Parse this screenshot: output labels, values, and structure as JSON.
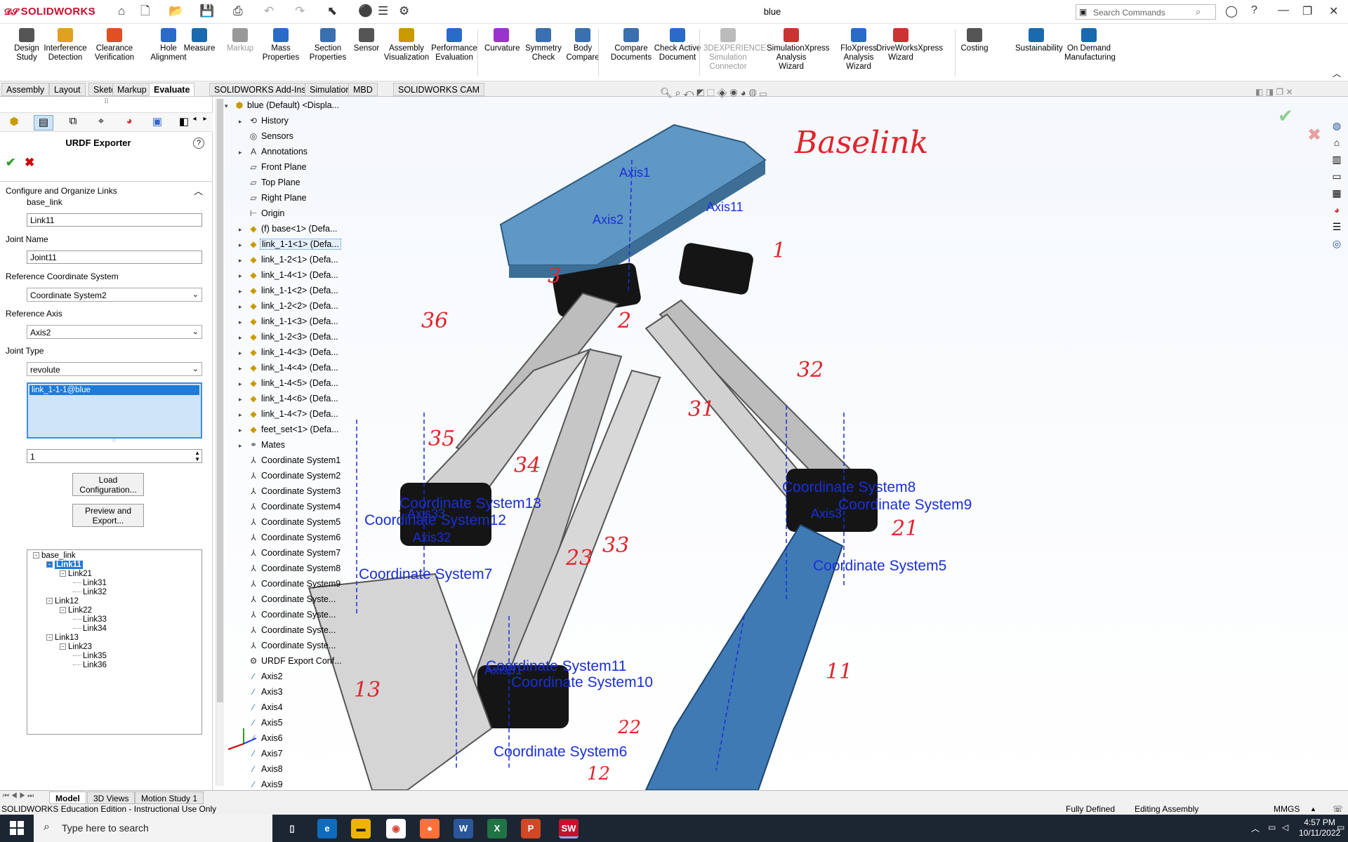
{
  "app": {
    "logo": "SOLIDWORKS",
    "window_title": "blue"
  },
  "search": {
    "placeholder": "Search Commands"
  },
  "ribbon": [
    {
      "label": "Design Study",
      "icon": "design-study-icon"
    },
    {
      "label": "Interference Detection",
      "icon": "interference-icon"
    },
    {
      "label": "Clearance Verification",
      "icon": "clearance-icon"
    },
    {
      "label": "Hole Alignment",
      "icon": "hole-alignment-icon"
    },
    {
      "label": "Measure",
      "icon": "measure-icon"
    },
    {
      "label": "Markup",
      "icon": "markup-icon",
      "disabled": true
    },
    {
      "label": "Mass Properties",
      "icon": "mass-properties-icon"
    },
    {
      "label": "Section Properties",
      "icon": "section-properties-icon"
    },
    {
      "label": "Sensor",
      "icon": "sensor-icon"
    },
    {
      "label": "Assembly Visualization",
      "icon": "assembly-visualization-icon"
    },
    {
      "label": "Performance Evaluation",
      "icon": "performance-icon"
    },
    {
      "label": "Curvature",
      "icon": "curvature-icon"
    },
    {
      "label": "Symmetry Check",
      "icon": "symmetry-icon"
    },
    {
      "label": "Body Compare",
      "icon": "body-compare-icon"
    },
    {
      "label": "Compare Documents",
      "icon": "compare-documents-icon"
    },
    {
      "label": "Check Active Document",
      "icon": "check-document-icon"
    },
    {
      "label": "3DEXPERIENCE Simulation Connector",
      "icon": "3dx-icon",
      "disabled": true
    },
    {
      "label": "SimulationXpress Analysis Wizard",
      "icon": "simxpress-icon"
    },
    {
      "label": "FloXpress Analysis Wizard",
      "icon": "floxpress-icon"
    },
    {
      "label": "DriveWorksXpress Wizard",
      "icon": "driveworks-icon"
    },
    {
      "label": "Costing",
      "icon": "costing-icon"
    },
    {
      "label": "Sustainability",
      "icon": "sustainability-icon"
    },
    {
      "label": "On Demand Manufacturing",
      "icon": "manufacturing-icon"
    }
  ],
  "tabs": [
    "Assembly",
    "Layout",
    "Sketch",
    "Markup",
    "Evaluate",
    "SOLIDWORKS Add-Ins",
    "Simulation",
    "MBD",
    "SOLIDWORKS CAM"
  ],
  "panel": {
    "title": "URDF Exporter",
    "section": "Configure and Organize Links",
    "link_label": "base_link",
    "link_value": "Link11",
    "joint_name_label": "Joint Name",
    "joint_name_value": "Joint11",
    "ref_cs_label": "Reference Coordinate System",
    "ref_cs_value": "Coordinate System2",
    "ref_axis_label": "Reference Axis",
    "ref_axis_value": "Axis2",
    "joint_type_label": "Joint Type",
    "joint_type_value": "revolute",
    "list_selected": "link_1-1-1@blue",
    "spinner_value": "1",
    "load_button": "Load Configuration...",
    "preview_button": "Preview and Export..."
  },
  "link_tree": [
    {
      "label": "base_link",
      "level": 0,
      "box": "-"
    },
    {
      "label": "Link11",
      "level": 1,
      "box": "-",
      "selected": true
    },
    {
      "label": "Link21",
      "level": 2,
      "box": "-"
    },
    {
      "label": "Link31",
      "level": 3
    },
    {
      "label": "Link32",
      "level": 3
    },
    {
      "label": "Link12",
      "level": 1,
      "box": "-"
    },
    {
      "label": "Link22",
      "level": 2,
      "box": "-"
    },
    {
      "label": "Link33",
      "level": 3
    },
    {
      "label": "Link34",
      "level": 3
    },
    {
      "label": "Link13",
      "level": 1,
      "box": "-"
    },
    {
      "label": "Link23",
      "level": 2,
      "box": "-"
    },
    {
      "label": "Link35",
      "level": 3
    },
    {
      "label": "Link36",
      "level": 3
    }
  ],
  "feature_tree": [
    {
      "label": "blue (Default) <Displa...",
      "exp": "▾",
      "icon": "assembly-icon"
    },
    {
      "label": "History",
      "exp": "▸",
      "icon": "history-icon"
    },
    {
      "label": "Sensors",
      "exp": "",
      "icon": "sensor-icon"
    },
    {
      "label": "Annotations",
      "exp": "▸",
      "icon": "annotation-icon"
    },
    {
      "label": "Front Plane",
      "exp": "",
      "icon": "plane-icon"
    },
    {
      "label": "Top Plane",
      "exp": "",
      "icon": "plane-icon"
    },
    {
      "label": "Right Plane",
      "exp": "",
      "icon": "plane-icon"
    },
    {
      "label": "Origin",
      "exp": "",
      "icon": "origin-icon"
    },
    {
      "label": "(f) base<1> (Defa...",
      "exp": "▸",
      "icon": "part-icon"
    },
    {
      "label": "link_1-1<1> (Defa...",
      "exp": "▸",
      "icon": "part-icon",
      "selected": true
    },
    {
      "label": "link_1-2<1> (Defa...",
      "exp": "▸",
      "icon": "part-icon"
    },
    {
      "label": "link_1-4<1> (Defa...",
      "exp": "▸",
      "icon": "part-icon"
    },
    {
      "label": "link_1-1<2> (Defa...",
      "exp": "▸",
      "icon": "part-icon"
    },
    {
      "label": "link_1-2<2> (Defa...",
      "exp": "▸",
      "icon": "part-icon"
    },
    {
      "label": "link_1-1<3> (Defa...",
      "exp": "▸",
      "icon": "part-icon"
    },
    {
      "label": "link_1-2<3> (Defa...",
      "exp": "▸",
      "icon": "part-icon"
    },
    {
      "label": "link_1-4<3> (Defa...",
      "exp": "▸",
      "icon": "part-icon"
    },
    {
      "label": "link_1-4<4> (Defa...",
      "exp": "▸",
      "icon": "part-icon"
    },
    {
      "label": "link_1-4<5> (Defa...",
      "exp": "▸",
      "icon": "part-icon"
    },
    {
      "label": "link_1-4<6> (Defa...",
      "exp": "▸",
      "icon": "part-icon"
    },
    {
      "label": "link_1-4<7> (Defa...",
      "exp": "▸",
      "icon": "part-icon"
    },
    {
      "label": "feet_set<1> (Defa...",
      "exp": "▸",
      "icon": "part-icon"
    },
    {
      "label": "Mates",
      "exp": "▸",
      "icon": "mates-icon"
    },
    {
      "label": "Coordinate System1",
      "exp": "",
      "icon": "coordinate-system-icon"
    },
    {
      "label": "Coordinate System2",
      "exp": "",
      "icon": "coordinate-system-icon"
    },
    {
      "label": "Coordinate System3",
      "exp": "",
      "icon": "coordinate-system-icon"
    },
    {
      "label": "Coordinate System4",
      "exp": "",
      "icon": "coordinate-system-icon"
    },
    {
      "label": "Coordinate System5",
      "exp": "",
      "icon": "coordinate-system-icon"
    },
    {
      "label": "Coordinate System6",
      "exp": "",
      "icon": "coordinate-system-icon"
    },
    {
      "label": "Coordinate System7",
      "exp": "",
      "icon": "coordinate-system-icon"
    },
    {
      "label": "Coordinate System8",
      "exp": "",
      "icon": "coordinate-system-icon"
    },
    {
      "label": "Coordinate System9",
      "exp": "",
      "icon": "coordinate-system-icon"
    },
    {
      "label": "Coordinate Syste...",
      "exp": "",
      "icon": "coordinate-system-icon"
    },
    {
      "label": "Coordinate Syste...",
      "exp": "",
      "icon": "coordinate-system-icon"
    },
    {
      "label": "Coordinate Syste...",
      "exp": "",
      "icon": "coordinate-system-icon"
    },
    {
      "label": "Coordinate Syste...",
      "exp": "",
      "icon": "coordinate-system-icon"
    },
    {
      "label": "URDF Export Conf...",
      "exp": "",
      "icon": "urdf-config-icon"
    },
    {
      "label": "Axis2",
      "exp": "",
      "icon": "axis-icon"
    },
    {
      "label": "Axis3",
      "exp": "",
      "icon": "axis-icon"
    },
    {
      "label": "Axis4",
      "exp": "",
      "icon": "axis-icon"
    },
    {
      "label": "Axis5",
      "exp": "",
      "icon": "axis-icon"
    },
    {
      "label": "Axis6",
      "exp": "",
      "icon": "axis-icon"
    },
    {
      "label": "Axis7",
      "exp": "",
      "icon": "axis-icon"
    },
    {
      "label": "Axis8",
      "exp": "",
      "icon": "axis-icon"
    },
    {
      "label": "Axis9",
      "exp": "",
      "icon": "axis-icon"
    }
  ],
  "annotations": {
    "hand": [
      "Baselink",
      "1",
      "2",
      "3",
      "36",
      "35",
      "34",
      "33",
      "32",
      "31",
      "21",
      "22",
      "23",
      "13",
      "12",
      "11"
    ],
    "coord": [
      "Coordinate System13",
      "Coordinate System12",
      "Coordinate System7",
      "Coordinate System8",
      "Coordinate System9",
      "Coordinate System5",
      "Coordinate System11",
      "Coordinate System10",
      "Coordinate System6"
    ],
    "axes": [
      "Axis1",
      "Axis2",
      "Axis11",
      "Axis33",
      "Axis32",
      "Axis31",
      "Axis3"
    ]
  },
  "bottom_tabs": [
    "Model",
    "3D Views",
    "Motion Study 1"
  ],
  "status": {
    "edition": "SOLIDWORKS Education Edition - Instructional Use Only",
    "defined": "Fully Defined",
    "mode": "Editing Assembly",
    "units": "MMGS"
  },
  "taskbar": {
    "search_placeholder": "Type here to search",
    "time": "4:57 PM",
    "date": "10/11/2022",
    "apps": [
      "task-view-icon",
      "edge-icon",
      "file-explorer-icon",
      "chrome-icon",
      "firefox-icon",
      "word-icon",
      "excel-icon",
      "powerpoint-icon",
      "solidworks-icon"
    ]
  },
  "colors": {
    "accent": "#1e7bd7",
    "link_blue": "#4a86b8",
    "link_gray": "#c8c8c8",
    "annotation_red": "#e0252d",
    "annotation_blue": "#1a2fd6"
  }
}
